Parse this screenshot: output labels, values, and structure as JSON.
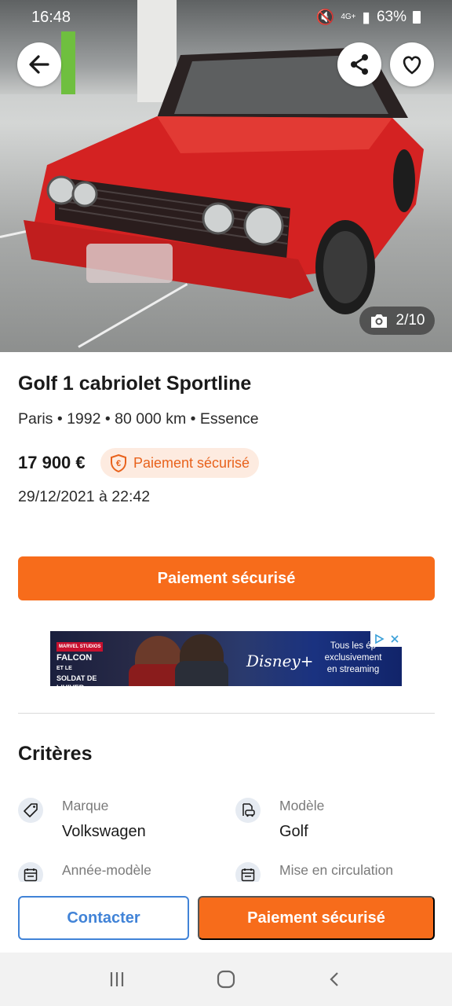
{
  "status_bar": {
    "time": "16:48",
    "network": "4G+",
    "battery": "63%"
  },
  "gallery": {
    "counter": "2/10",
    "back_icon": "arrow-left-icon",
    "share_icon": "share-icon",
    "favorite_icon": "heart-outline-icon",
    "camera_icon": "camera-icon"
  },
  "listing": {
    "title": "Golf 1 cabriolet Sportline",
    "subtitle": "Paris • 1992 • 80 000 km • Essence",
    "price": "17 900 €",
    "secure_badge": "Paiement sécurisé",
    "date": "29/12/2021 à 22:42",
    "primary_button": "Paiement sécurisé"
  },
  "ad": {
    "brand_tag": "MARVEL STUDIOS",
    "brand_line1": "FALCON",
    "brand_line2": "ET LE",
    "brand_line3": "SOLDAT DE L'HIVER",
    "logo": "Disney+",
    "copy_line1": "Tous les ép",
    "copy_line2": "exclusivement",
    "copy_line3": "en streaming"
  },
  "criteria": {
    "title": "Critères",
    "items": [
      {
        "label": "Marque",
        "value": "Volkswagen",
        "icon": "tag-icon"
      },
      {
        "label": "Modèle",
        "value": "Golf",
        "icon": "car-document-icon"
      },
      {
        "label": "Année-modèle",
        "value": "",
        "icon": "calendar-icon"
      },
      {
        "label": "Mise en circulation",
        "value": "",
        "icon": "calendar-icon"
      }
    ]
  },
  "actions": {
    "contact": "Contacter",
    "pay": "Paiement sécurisé"
  },
  "colors": {
    "accent_orange": "#f76c1b",
    "accent_blue": "#4183d7",
    "badge_bg": "#fdebe0"
  }
}
